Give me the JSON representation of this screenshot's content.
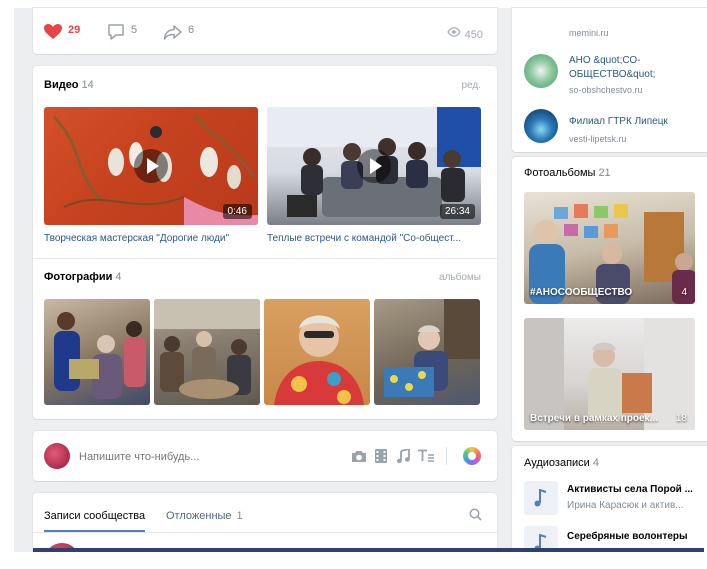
{
  "post_actions": {
    "likes": "29",
    "comments": "5",
    "shares": "6",
    "views": "450"
  },
  "sidebar_links": [
    {
      "name": "memini.ru",
      "sub": ""
    },
    {
      "name": "АНО &quot;СО-ОБЩЕСТВО&quot;",
      "sub": "so-obshchestvo.ru"
    },
    {
      "name": "Филиал ГТРК Липецк",
      "sub": "vesti-lipetsk.ru"
    }
  ],
  "videos": {
    "title": "Видео",
    "count": "14",
    "edit": "ред.",
    "items": [
      {
        "caption": "Творческая мастерская \"Дорогие люди\"",
        "duration": "0:46"
      },
      {
        "caption": "Теплые встречи с командой \"Со-общест...",
        "duration": "26:34"
      }
    ]
  },
  "photos": {
    "title": "Фотографии",
    "count": "4",
    "albums_link": "альбомы"
  },
  "albums": {
    "title": "Фотоальбомы",
    "count": "21",
    "items": [
      {
        "caption": "#АНОСООБЩЕСТВО",
        "count": "4"
      },
      {
        "caption": "Встречи в рамках проек...",
        "count": "18"
      }
    ]
  },
  "composer": {
    "placeholder": "Напишите что-нибудь..."
  },
  "wall_tabs": {
    "posts": "Записи сообщества",
    "postponed": "Отложенные",
    "postponed_count": "1"
  },
  "audio": {
    "title": "Аудиозаписи",
    "count": "4",
    "items": [
      {
        "title": "Активисты села Порой ...",
        "artist": "Ирина Карасюк и актив..."
      },
      {
        "title": "Серебряные волонтеры",
        "artist": ""
      }
    ]
  },
  "colors": {
    "accent": "#2a5885",
    "like": "#e64646",
    "tab_underline": "#5181b8",
    "bottom_bar": "#2f3f6e"
  }
}
